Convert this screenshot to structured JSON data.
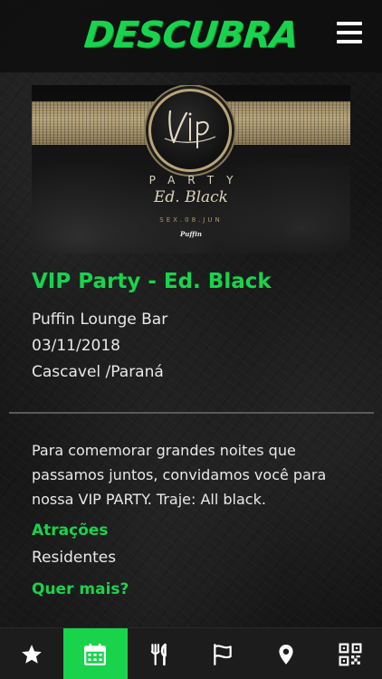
{
  "header": {
    "brand": "DESCUBRA",
    "menu_icon": "hamburger-menu-icon"
  },
  "banner": {
    "logo_text": "Vip",
    "party_text": "PARTY",
    "edition_text": "Ed. Black",
    "date_text": "SEX.08.JUN",
    "venue_logo_text": "Puffin"
  },
  "event": {
    "title": "VIP Party - Ed. Black",
    "venue": "Puffin Lounge Bar",
    "date": "03/11/2018",
    "location": "Cascavel /Paraná",
    "description": "Para comemorar grandes noites que passamos juntos, convidamos você para nossa VIP PARTY. Traje: All black.",
    "attractions_label": "Atrações",
    "attractions_value": "Residentes",
    "more_label": "Quer mais?"
  },
  "nav": {
    "items": [
      {
        "icon": "star-icon",
        "active": false
      },
      {
        "icon": "calendar-icon",
        "active": true
      },
      {
        "icon": "fork-knife-icon",
        "active": false
      },
      {
        "icon": "flag-icon",
        "active": false
      },
      {
        "icon": "map-pin-icon",
        "active": false
      },
      {
        "icon": "qr-code-icon",
        "active": false
      }
    ]
  },
  "colors": {
    "accent": "#19d34d",
    "background": "#141414",
    "nav_background": "#1c1c1c"
  }
}
